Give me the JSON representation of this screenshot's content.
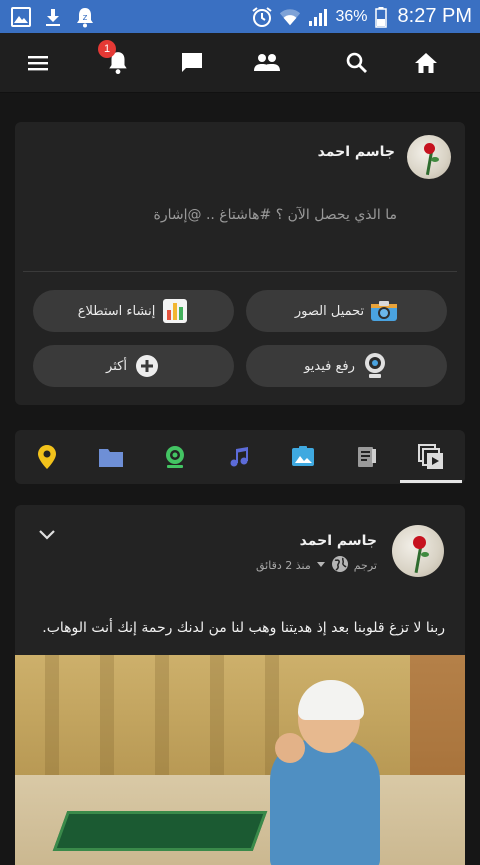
{
  "status_bar": {
    "battery": "36%",
    "time": "8:27 PM",
    "left_icons": [
      "gallery-icon",
      "download-icon",
      "notification-bell-icon"
    ],
    "right_icons": [
      "alarm-icon",
      "wifi-icon",
      "signal-icon",
      "battery-icon"
    ]
  },
  "header": {
    "icons": [
      "menu-icon",
      "notifications-icon",
      "messages-icon",
      "friends-icon",
      "search-icon",
      "home-icon"
    ],
    "notification_count": "1"
  },
  "composer": {
    "user_name": "جاسم احمد",
    "placeholder": "ما الذي يحصل الآن ؟ #هاشتاغ .. @إشارة",
    "actions": {
      "upload_photos": "تحميل الصور",
      "create_poll": "إنشاء استطلاع",
      "upload_video": "رفع فيديو",
      "more": "أكثر"
    }
  },
  "tabs": {
    "items": [
      "video-feed-icon",
      "articles-icon",
      "photos-icon",
      "music-icon",
      "webcam-icon",
      "files-icon",
      "location-icon"
    ],
    "active": "video-feed-icon",
    "colors": {
      "photos": "#3fa9e0",
      "music": "#5c6bd8",
      "webcam": "#43c463",
      "files": "#6e8fd6",
      "location": "#f2c21b"
    }
  },
  "post": {
    "user_name": "جاسم احمد",
    "translate": "ترجم",
    "time": "منذ 2 دقائق",
    "text": "ربنا لا تزغ قلوبنا بعد إذ هديتنا وهب لنا من لدنك رحمة إنك أنت الوهاب."
  }
}
